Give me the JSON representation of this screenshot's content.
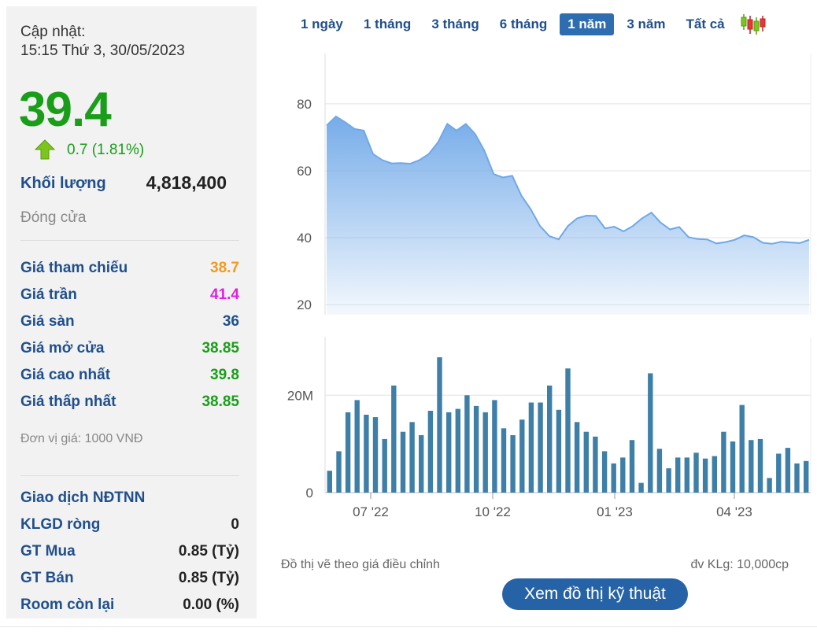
{
  "stock_panel": {
    "update_label": "Cập nhật:",
    "update_time": "15:15 Thứ 3, 30/05/2023",
    "price": "39.4",
    "change": "0.7 (1.81%)",
    "change_direction": "up",
    "volume_label": "Khối lượng",
    "volume_value": "4,818,400",
    "status": "Đóng cửa",
    "price_rows": [
      {
        "label": "Giá tham chiếu",
        "value": "38.7",
        "color": "#f39a1e"
      },
      {
        "label": "Giá trần",
        "value": "41.4",
        "color": "#e21ee2"
      },
      {
        "label": "Giá sàn",
        "value": "36",
        "color": "#1f4f8c"
      },
      {
        "label": "Giá mở cửa",
        "value": "38.85",
        "color": "#1a9e1a"
      },
      {
        "label": "Giá cao nhất",
        "value": "39.8",
        "color": "#1a9e1a"
      },
      {
        "label": "Giá thấp nhất",
        "value": "38.85",
        "color": "#1a9e1a"
      }
    ],
    "unit_note": "Đơn vị giá: 1000 VNĐ",
    "foreign": {
      "title": "Giao dịch NĐTNN",
      "rows": [
        {
          "label": "KLGD ròng",
          "value": "0"
        },
        {
          "label": "GT Mua",
          "value": "0.85 (Tỷ)"
        },
        {
          "label": "GT Bán",
          "value": "0.85 (Tỷ)"
        },
        {
          "label": "Room còn lại",
          "value": "0.00 (%)"
        }
      ]
    }
  },
  "tabs": [
    {
      "label": "1 ngày",
      "active": false
    },
    {
      "label": "1 tháng",
      "active": false
    },
    {
      "label": "3 tháng",
      "active": false
    },
    {
      "label": "6 tháng",
      "active": false
    },
    {
      "label": "1 năm",
      "active": true
    },
    {
      "label": "3 năm",
      "active": false
    },
    {
      "label": "Tất cả",
      "active": false
    }
  ],
  "candlestick_icon": "candlestick-chart-icon",
  "chart_data": [
    {
      "type": "area",
      "y_ticks": [
        "80",
        "60",
        "40",
        "20"
      ],
      "ylim": [
        17,
        95
      ],
      "x_tick_labels": [
        "07 '22",
        "10 '22",
        "01 '23",
        "04 '23"
      ],
      "values": [
        73.5,
        76.2,
        74.5,
        72.5,
        72,
        65,
        63.2,
        62.2,
        62.3,
        62.1,
        63.2,
        65,
        68.5,
        74,
        72,
        74,
        71,
        66,
        59,
        58,
        58.5,
        52.5,
        48.5,
        43.5,
        40.5,
        39.5,
        43.5,
        45.8,
        46.6,
        46.5,
        42.8,
        43.3,
        41.9,
        43.5,
        45.8,
        47.5,
        44.5,
        42.5,
        43.2,
        40.2,
        39.6,
        39.5,
        38.3,
        38.7,
        39.4,
        40.7,
        40.2,
        38.5,
        38.2,
        38.8,
        38.6,
        38.4,
        39.4
      ],
      "fill_color": "#6fa8e8",
      "line_color": "#6fa8e8"
    },
    {
      "type": "bar",
      "y_ticks": [
        "20M",
        "0"
      ],
      "ylim": [
        0,
        32
      ],
      "x_tick_labels": [
        "07 '22",
        "10 '22",
        "01 '23",
        "04 '23"
      ],
      "values": [
        4.5,
        8.5,
        16.5,
        19,
        16,
        15.5,
        11,
        22,
        12.5,
        14.5,
        11.8,
        16.8,
        27.8,
        16.5,
        17.2,
        20,
        17.8,
        16.5,
        19,
        13.2,
        11.8,
        15,
        18.5,
        18.5,
        22,
        17,
        25.5,
        14.5,
        12.5,
        11.5,
        8.5,
        6,
        7.2,
        10.8,
        2,
        24.5,
        9,
        5,
        7.2,
        7.2,
        8.2,
        7,
        7.5,
        12.5,
        10.5,
        18,
        10.8,
        11,
        3,
        8,
        9.2,
        6,
        6.5
      ],
      "bar_color": "#3e7fa8",
      "unit_note": "đv KLg: 10,000cp"
    }
  ],
  "chart_note": "Đồ thị vẽ theo giá điều chỉnh",
  "tech_button": "Xem đồ thị kỹ thuật"
}
